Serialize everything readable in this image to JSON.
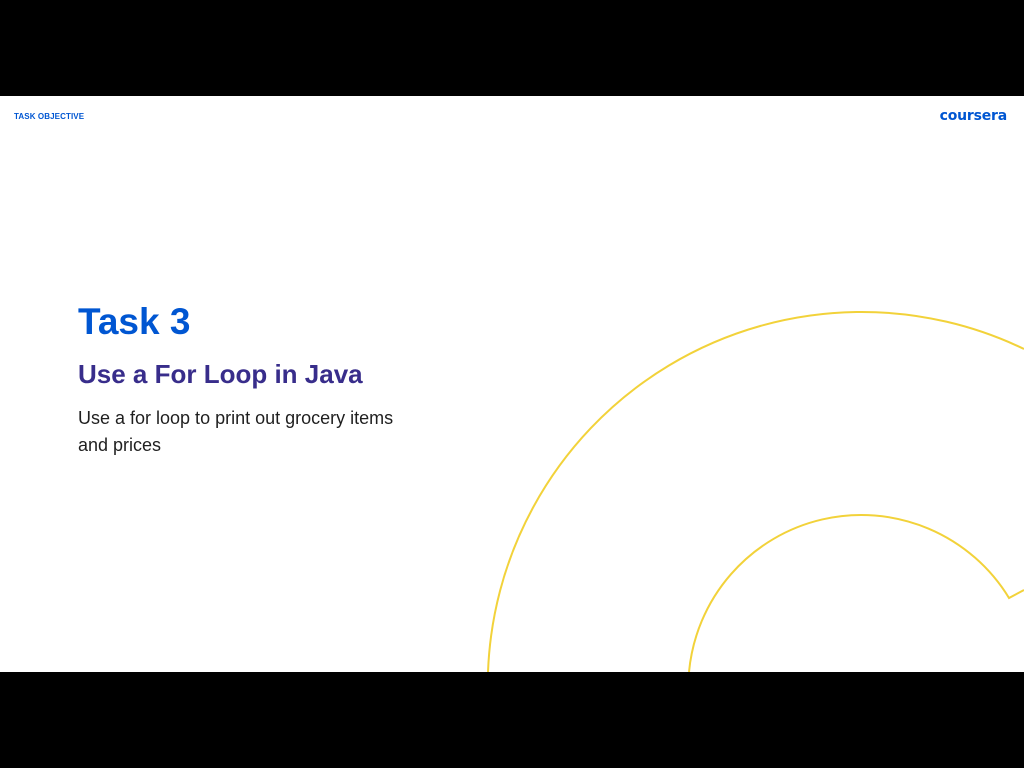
{
  "header": {
    "section_label": "TASK OBJECTIVE",
    "brand": "coursera"
  },
  "main": {
    "title": "Task 3",
    "subtitle": "Use a For Loop in Java",
    "description": "Use a for loop to print out grocery items and prices"
  },
  "colors": {
    "brand_blue": "#0056d2",
    "subtitle_purple": "#382d8b",
    "decor_yellow": "#f2d23a",
    "letterbox": "#000000"
  }
}
